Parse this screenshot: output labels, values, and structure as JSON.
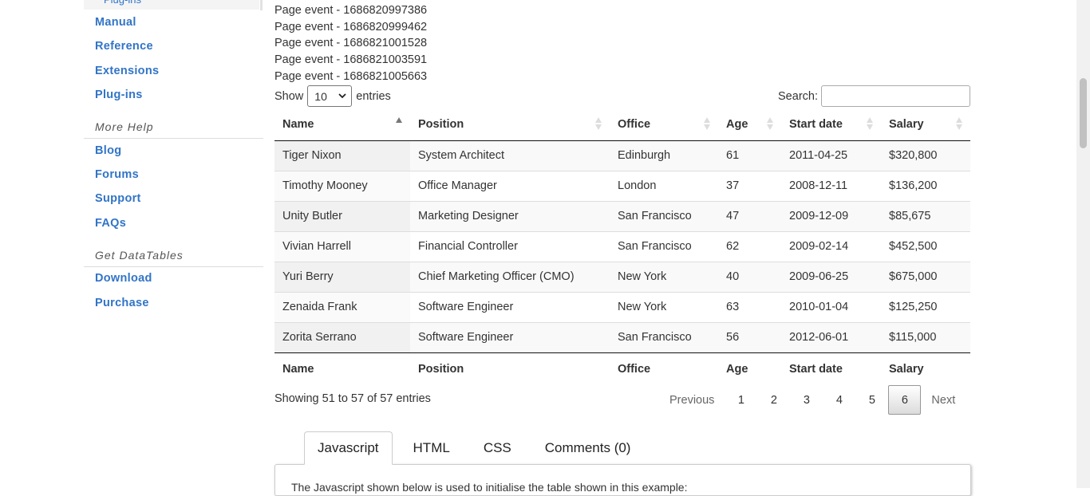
{
  "sidebar": {
    "cut_item": "Plug-ins",
    "sections": [
      {
        "links": [
          "Manual",
          "Reference",
          "Extensions",
          "Plug-ins"
        ]
      },
      {
        "heading": "More Help",
        "links": [
          "Blog",
          "Forums",
          "Support",
          "FAQs"
        ]
      },
      {
        "heading": "Get DataTables",
        "links": [
          "Download",
          "Purchase"
        ]
      }
    ]
  },
  "events": [
    "Page event - 1686820997386",
    "Page event - 1686820999462",
    "Page event - 1686821001528",
    "Page event - 1686821003591",
    "Page event - 1686821005663"
  ],
  "length": {
    "prefix": "Show",
    "value": "10",
    "suffix": "entries"
  },
  "search": {
    "label": "Search:",
    "value": ""
  },
  "table": {
    "columns": [
      "Name",
      "Position",
      "Office",
      "Age",
      "Start date",
      "Salary"
    ],
    "sorted_column": "Name",
    "sort_direction": "ascending",
    "rows": [
      [
        "Tiger Nixon",
        "System Architect",
        "Edinburgh",
        "61",
        "2011-04-25",
        "$320,800"
      ],
      [
        "Timothy Mooney",
        "Office Manager",
        "London",
        "37",
        "2008-12-11",
        "$136,200"
      ],
      [
        "Unity Butler",
        "Marketing Designer",
        "San Francisco",
        "47",
        "2009-12-09",
        "$85,675"
      ],
      [
        "Vivian Harrell",
        "Financial Controller",
        "San Francisco",
        "62",
        "2009-02-14",
        "$452,500"
      ],
      [
        "Yuri Berry",
        "Chief Marketing Officer (CMO)",
        "New York",
        "40",
        "2009-06-25",
        "$675,000"
      ],
      [
        "Zenaida Frank",
        "Software Engineer",
        "New York",
        "63",
        "2010-01-04",
        "$125,250"
      ],
      [
        "Zorita Serrano",
        "Software Engineer",
        "San Francisco",
        "56",
        "2012-06-01",
        "$115,000"
      ]
    ]
  },
  "info": "Showing 51 to 57 of 57 entries",
  "pagination": {
    "previous": "Previous",
    "pages": [
      "1",
      "2",
      "3",
      "4",
      "5",
      "6"
    ],
    "current": "6",
    "next": "Next"
  },
  "tabs": {
    "items": [
      "Javascript",
      "HTML",
      "CSS",
      "Comments (0)"
    ],
    "active": "Javascript",
    "panel_text": "The Javascript shown below is used to initialise the table shown in this example:"
  },
  "colors": {
    "link": "#3174c7",
    "text": "#333333",
    "header_rule": "#111111"
  }
}
